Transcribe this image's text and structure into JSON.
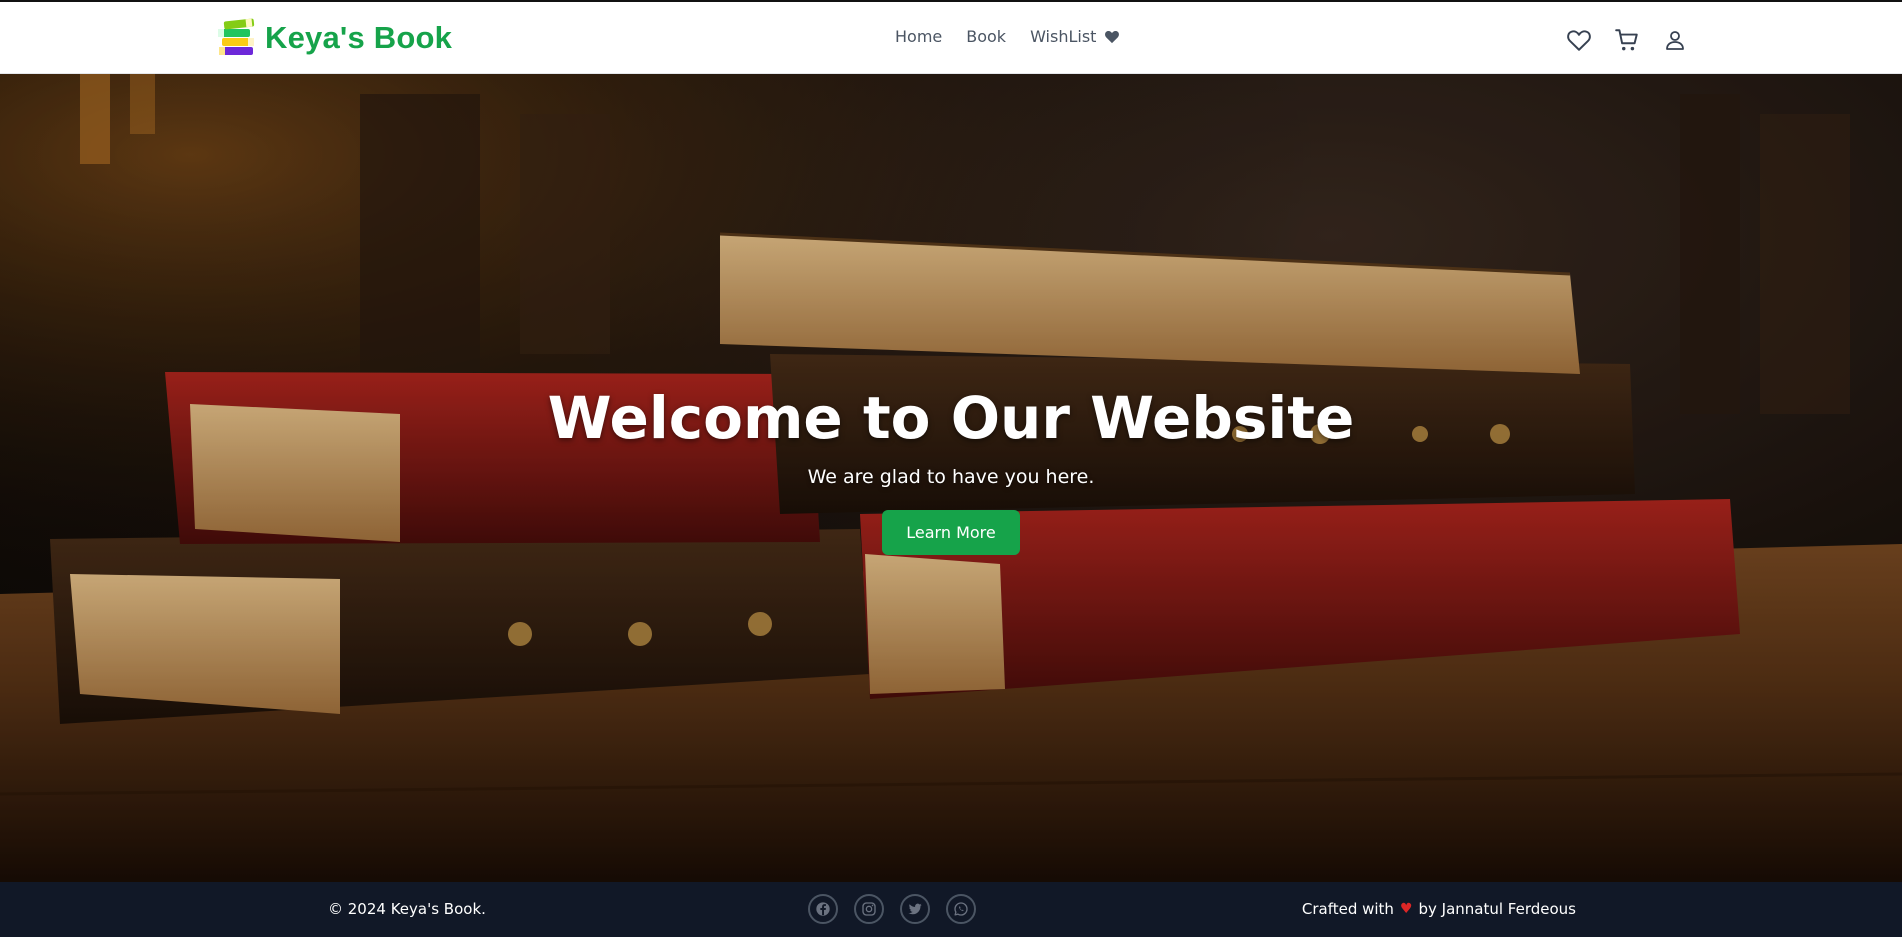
{
  "brand": {
    "name": "Keya's Book",
    "color": "#16a34a"
  },
  "nav": {
    "links": [
      {
        "label": "Home"
      },
      {
        "label": "Book"
      },
      {
        "label": "WishList"
      }
    ],
    "icons": [
      "heart-outline-icon",
      "cart-icon",
      "user-icon"
    ]
  },
  "hero": {
    "title": "Welcome to Our Website",
    "subtitle": "We are glad to have you here.",
    "button_label": "Learn More",
    "button_color": "#16a34a"
  },
  "footer": {
    "copyright": "© 2024 Keya's Book.",
    "social": [
      "facebook-icon",
      "instagram-icon",
      "twitter-icon",
      "whatsapp-icon"
    ],
    "credit_prefix": "Crafted with",
    "credit_suffix": "by Jannatul Ferdeous",
    "heart_color": "#dc2626"
  }
}
